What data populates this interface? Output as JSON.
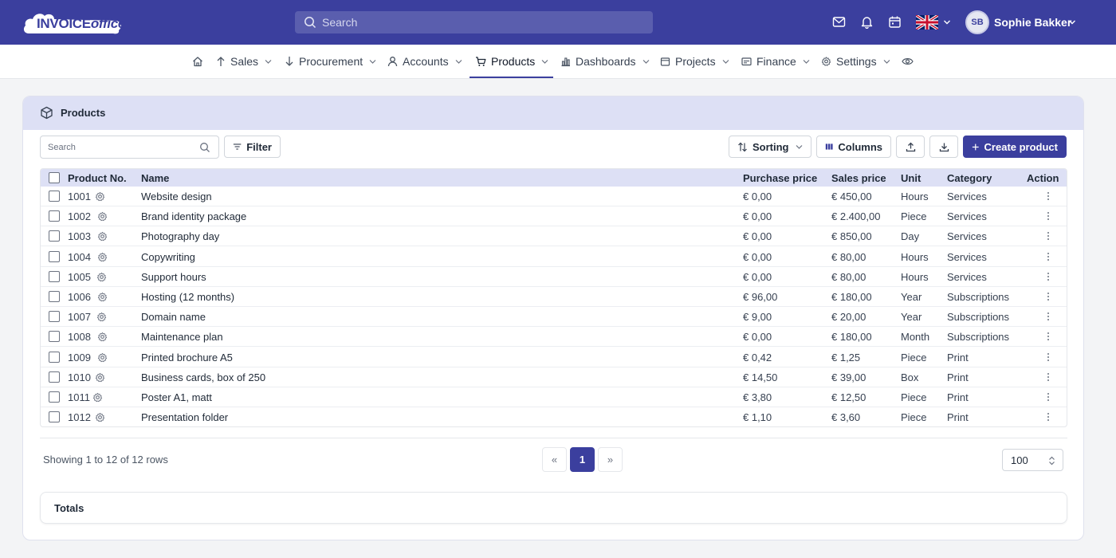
{
  "topbar": {
    "logo_word_1": "INVOICE",
    "logo_word_2": "office",
    "search_placeholder": "Search",
    "user_initials": "SB",
    "user_name": "Sophie Bakker",
    "language_flag": "uk-flag-icon",
    "icons": [
      "mail-icon",
      "bell-icon",
      "calendar-icon"
    ],
    "brand_color": "#3b3f9e"
  },
  "nav": {
    "items": [
      {
        "label": "Sales",
        "icon": "upload-arrow-icon"
      },
      {
        "label": "Procurement",
        "icon": "download-arrow-icon"
      },
      {
        "label": "Accounts",
        "icon": "user-icon"
      },
      {
        "label": "Products",
        "icon": "cart-icon",
        "active": true
      },
      {
        "label": "Dashboards",
        "icon": "bar-chart-icon"
      },
      {
        "label": "Projects",
        "icon": "folder-icon"
      },
      {
        "label": "Finance",
        "icon": "wallet-icon"
      },
      {
        "label": "Settings",
        "icon": "gear-icon"
      }
    ]
  },
  "products": {
    "title": "Products",
    "search_placeholder": "Search",
    "filter_label": "Filter",
    "sorting_label": "Sorting",
    "columns_label": "Columns",
    "create_label": "Create product",
    "headers": {
      "product_no": "Product No.",
      "name": "Name",
      "purchase_price": "Purchase price",
      "sales_price": "Sales price",
      "unit": "Unit",
      "category": "Category",
      "action": "Action"
    },
    "rows": [
      {
        "no": "1001",
        "name": "Website design",
        "purchase": "€ 0,00",
        "sales": "€ 450,00",
        "unit": "Hours",
        "category": "Services"
      },
      {
        "no": "1002",
        "name": "Brand identity package",
        "purchase": "€ 0,00",
        "sales": "€ 2.400,00",
        "unit": "Piece",
        "category": "Services"
      },
      {
        "no": "1003",
        "name": "Photography day",
        "purchase": "€ 0,00",
        "sales": "€ 850,00",
        "unit": "Day",
        "category": "Services"
      },
      {
        "no": "1004",
        "name": "Copywriting",
        "purchase": "€ 0,00",
        "sales": "€ 80,00",
        "unit": "Hours",
        "category": "Services"
      },
      {
        "no": "1005",
        "name": "Support hours",
        "purchase": "€ 0,00",
        "sales": "€ 80,00",
        "unit": "Hours",
        "category": "Services"
      },
      {
        "no": "1006",
        "name": "Hosting (12 months)",
        "purchase": "€ 96,00",
        "sales": "€ 180,00",
        "unit": "Year",
        "category": "Subscriptions"
      },
      {
        "no": "1007",
        "name": "Domain name",
        "purchase": "€ 9,00",
        "sales": "€ 20,00",
        "unit": "Year",
        "category": "Subscriptions"
      },
      {
        "no": "1008",
        "name": "Maintenance plan",
        "purchase": "€ 0,00",
        "sales": "€ 180,00",
        "unit": "Month",
        "category": "Subscriptions"
      },
      {
        "no": "1009",
        "name": "Printed brochure A5",
        "purchase": "€ 0,42",
        "sales": "€ 1,25",
        "unit": "Piece",
        "category": "Print"
      },
      {
        "no": "1010",
        "name": "Business cards, box of 250",
        "purchase": "€ 14,50",
        "sales": "€ 39,00",
        "unit": "Box",
        "category": "Print"
      },
      {
        "no": "1011",
        "name": "Poster A1, matt",
        "purchase": "€ 3,80",
        "sales": "€ 12,50",
        "unit": "Piece",
        "category": "Print"
      },
      {
        "no": "1012",
        "name": "Presentation folder",
        "purchase": "€ 1,10",
        "sales": "€ 3,60",
        "unit": "Piece",
        "category": "Print"
      }
    ],
    "footer": {
      "rows_info": "Showing 1 to 12 of 12 rows",
      "prev_label": "«",
      "page_label": "1",
      "next_label": "»",
      "page_size": "100"
    },
    "totals_label": "Totals"
  }
}
